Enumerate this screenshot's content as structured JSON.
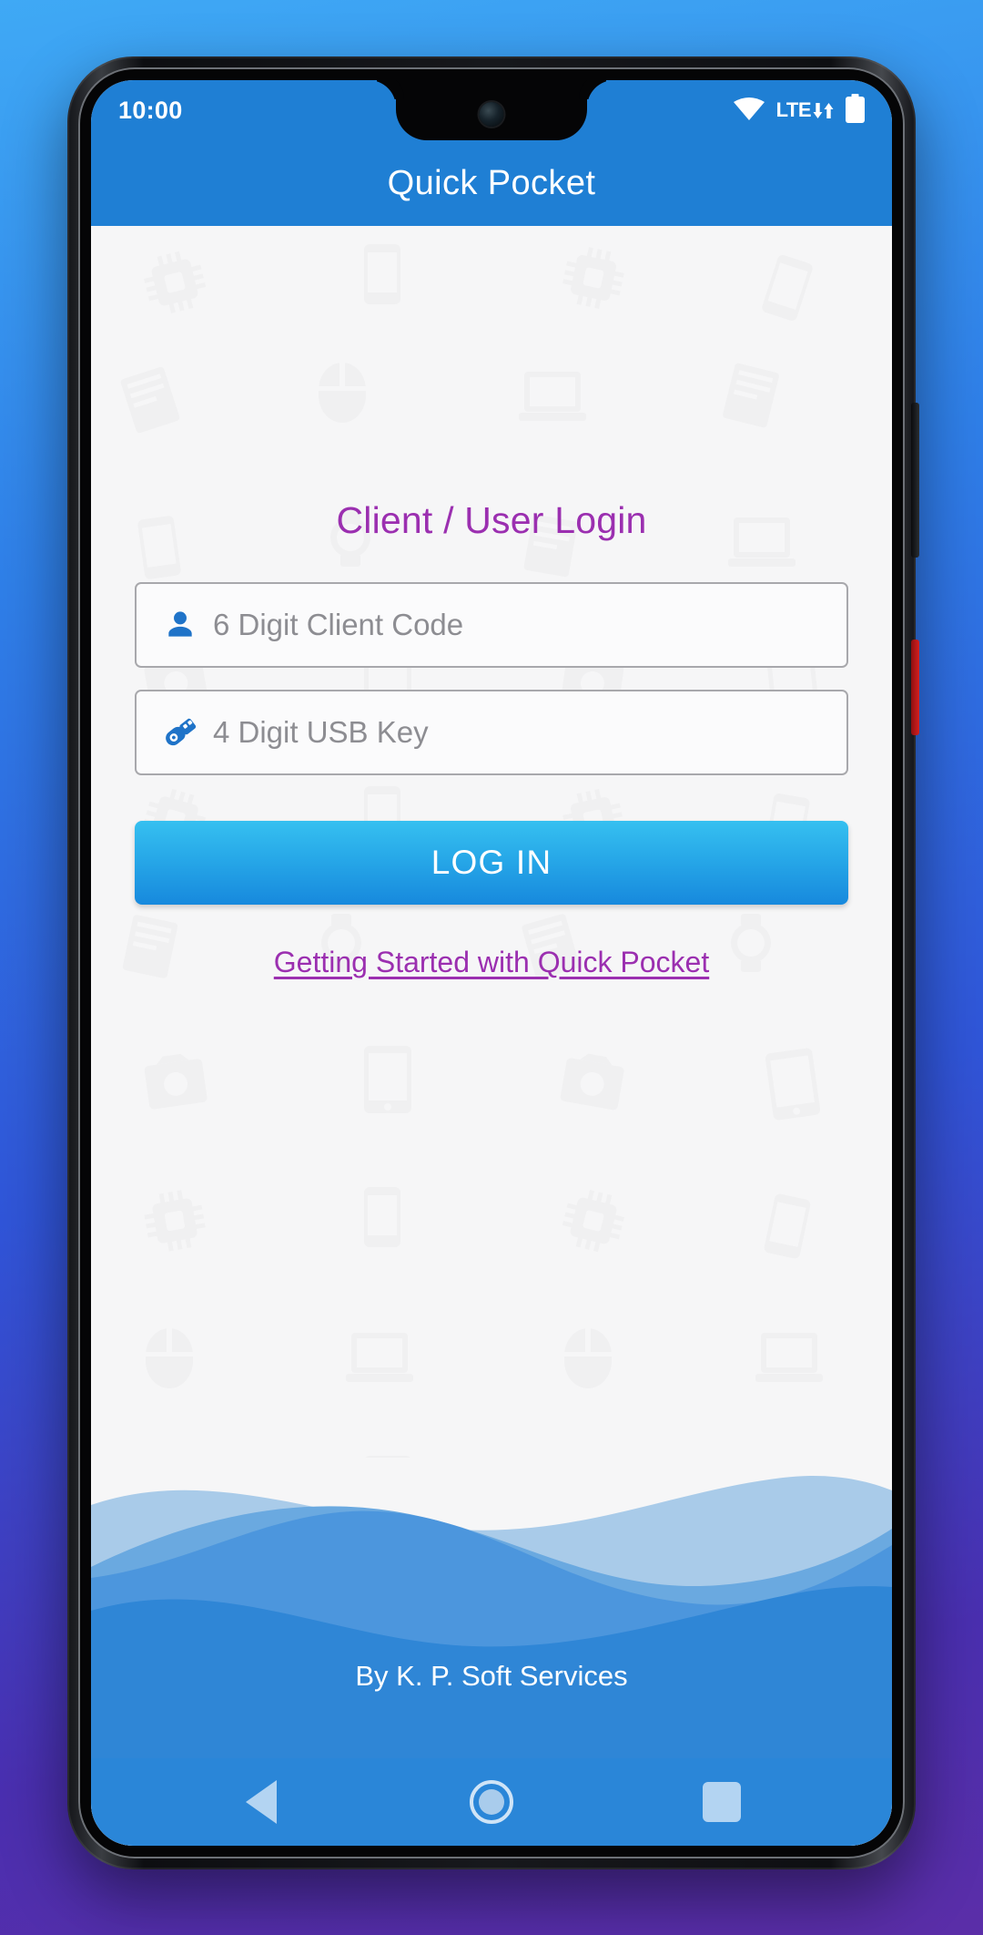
{
  "status_bar": {
    "time": "10:00",
    "network_label": "LTE",
    "icons": [
      "wifi-icon",
      "lte-indicator",
      "battery-icon"
    ]
  },
  "app_bar": {
    "title": "Quick Pocket"
  },
  "login": {
    "heading": "Client / User Login",
    "fields": [
      {
        "name": "client-code",
        "icon": "person-icon",
        "placeholder": "6 Digit Client Code",
        "value": ""
      },
      {
        "name": "usb-key",
        "icon": "usb-drive-icon",
        "placeholder": "4 Digit USB Key",
        "value": ""
      }
    ],
    "submit_label": "LOG IN",
    "help_link": "Getting Started with Quick Pocket"
  },
  "footer": {
    "credit": "By K. P. Soft Services"
  },
  "nav_bar": {
    "back": "back-icon",
    "home": "home-icon",
    "recents": "recents-icon"
  },
  "colors": {
    "app_bar": "#1f7fd4",
    "accent_purple": "#9b2fb0",
    "button_gradient_start": "#36c0f0",
    "button_gradient_end": "#1789dd",
    "wave_dark": "#2f86d6",
    "wave_mid": "#6aa9e0",
    "wave_light": "#a9cbe9",
    "nav_bar": "#2a86d8",
    "screen_bg": "#f6f6f7"
  }
}
